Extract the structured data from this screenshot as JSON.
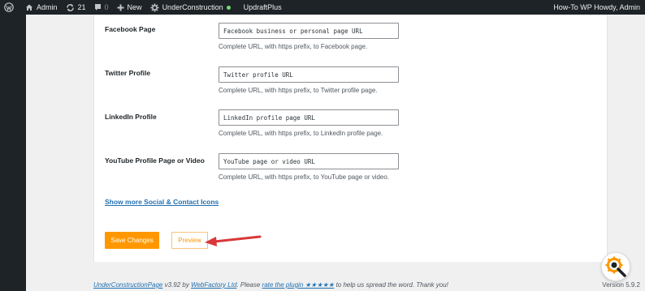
{
  "adminbar": {
    "site_name": "Admin",
    "updates_count": "21",
    "comments_count": "0",
    "new_label": "New",
    "plugin_label": "UnderConstruction",
    "updraft_label": "UpdraftPlus",
    "greeting": "How-To WP Howdy, Admin",
    "icons": [
      "wordpress-logo-icon",
      "home-icon",
      "updates-icon",
      "comment-icon",
      "plus-icon",
      "gear-icon"
    ]
  },
  "form": {
    "rows": [
      {
        "label": "Facebook Page",
        "placeholder": "Facebook business or personal page URL",
        "help": "Complete URL, with https prefix, to Facebook page."
      },
      {
        "label": "Twitter Profile",
        "placeholder": "Twitter profile URL",
        "help": "Complete URL, with https prefix, to Twitter profile page."
      },
      {
        "label": "LinkedIn Profile",
        "placeholder": "LinkedIn profile page URL",
        "help": "Complete URL, with https prefix, to LinkedIn profile page."
      },
      {
        "label": "YouTube Profile Page or Video",
        "placeholder": "YouTube page or video URL",
        "help": "Complete URL, with https prefix, to YouTube page or video."
      }
    ],
    "more_link": "Show more Social & Contact Icons",
    "save_label": "Save Changes",
    "preview_label": "Preview"
  },
  "footer": {
    "plugin_link": "UnderConstructionPage",
    "version_text": " v3.92 by ",
    "author_link": "WebFactory Ltd",
    "please_text": ". Please ",
    "rate_link": "rate the plugin ★★★★★",
    "rest_text": " to help us spread the word. Thank you!",
    "wp_version": "Version 5.9.2"
  },
  "colors": {
    "accent_orange": "#ff9800",
    "link_blue": "#2271b1",
    "adminbar_bg": "#1d2327",
    "arrow_red": "#d9383a"
  }
}
